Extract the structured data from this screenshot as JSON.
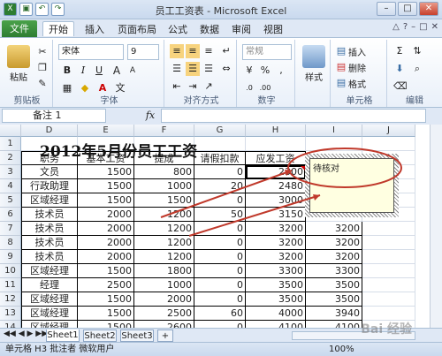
{
  "window": {
    "title": "员工工资表 - Microsoft Excel"
  },
  "tabs": [
    {
      "label": "文件"
    },
    {
      "label": "开始"
    },
    {
      "label": "插入"
    },
    {
      "label": "页面布局"
    },
    {
      "label": "公式"
    },
    {
      "label": "数据"
    },
    {
      "label": "审阅"
    },
    {
      "label": "视图"
    }
  ],
  "ribbon": {
    "paste_label": "粘贴",
    "clipboard_label": "剪贴板",
    "font_name": "宋体",
    "font_size": "9",
    "font_group_label": "字体",
    "align_group_label": "对齐方式",
    "number_format": "常规",
    "number_group_label": "数字",
    "styles_label": "样式",
    "insert_label": "插入",
    "delete_label": "删除",
    "format_label": "格式",
    "cells_group_label": "单元格",
    "edit_group_label": "编辑"
  },
  "formula_bar": {
    "name_box": "备注 1",
    "fx": "fx",
    "value": ""
  },
  "columns": [
    "D",
    "E",
    "F",
    "G",
    "H",
    "I",
    "J"
  ],
  "rows": [
    "1",
    "2",
    "3",
    "4",
    "5",
    "6",
    "7",
    "8",
    "9",
    "10",
    "11",
    "12",
    "13",
    "14",
    "15"
  ],
  "sheet": {
    "title": "2012年5月份员工工资",
    "headers": [
      "职务",
      "基本工资",
      "提成",
      "请假扣款",
      "应发工资"
    ],
    "data": [
      [
        "文员",
        "1500",
        "800",
        "0",
        "2300",
        ""
      ],
      [
        "行政助理",
        "1500",
        "1000",
        "20",
        "2480",
        ""
      ],
      [
        "区域经理",
        "1500",
        "1500",
        "0",
        "3000",
        ""
      ],
      [
        "技术员",
        "2000",
        "1200",
        "50",
        "3150",
        ""
      ],
      [
        "技术员",
        "2000",
        "1200",
        "0",
        "3200",
        "3200"
      ],
      [
        "技术员",
        "2000",
        "1200",
        "0",
        "3200",
        "3200"
      ],
      [
        "技术员",
        "2000",
        "1200",
        "0",
        "3200",
        "3200"
      ],
      [
        "区域经理",
        "1500",
        "1800",
        "0",
        "3300",
        "3300"
      ],
      [
        "经理",
        "2500",
        "1000",
        "0",
        "3500",
        "3500"
      ],
      [
        "区域经理",
        "1500",
        "2000",
        "0",
        "3500",
        "3500"
      ],
      [
        "区域经理",
        "1500",
        "2500",
        "60",
        "4000",
        "3940"
      ],
      [
        "区域经理",
        "1500",
        "2600",
        "0",
        "4100",
        "4100"
      ]
    ]
  },
  "comment": {
    "text": "待核对"
  },
  "sheet_tabs": [
    "Sheet1",
    "Sheet2",
    "Sheet3"
  ],
  "status": {
    "text": "单元格 H3 批注者 微软用户",
    "zoom": "100%"
  },
  "watermark": "Bai 经验"
}
